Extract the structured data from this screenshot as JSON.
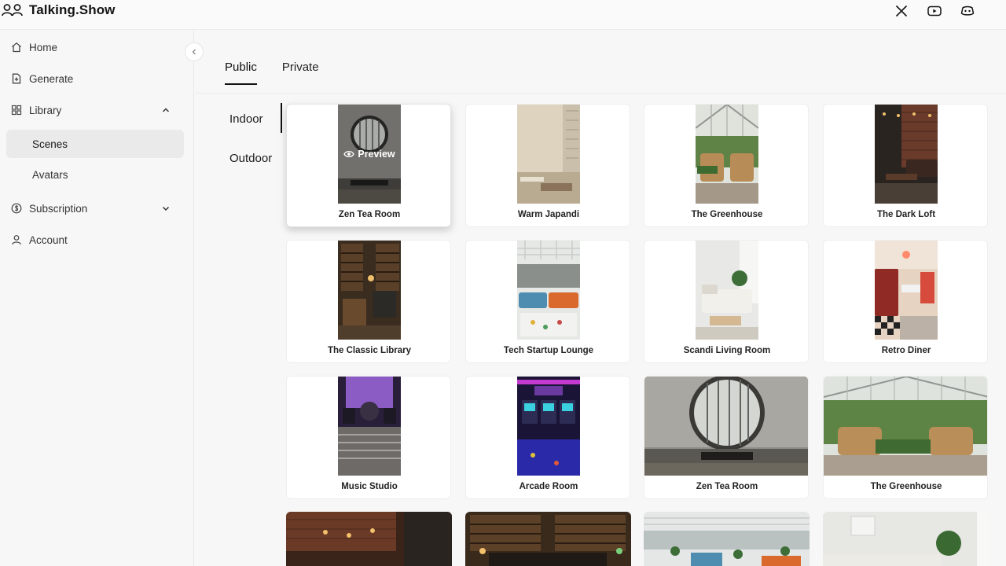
{
  "app": {
    "title": "Talking.Show"
  },
  "social": [
    {
      "icon": "x-twitter-icon"
    },
    {
      "icon": "youtube-icon"
    },
    {
      "icon": "discord-icon"
    }
  ],
  "sidebar": {
    "items": [
      {
        "label": "Home",
        "icon": "home-icon"
      },
      {
        "label": "Generate",
        "icon": "file-plus-icon"
      },
      {
        "label": "Library",
        "icon": "grid-icon",
        "expanded": true
      },
      {
        "label": "Scenes",
        "active": true
      },
      {
        "label": "Avatars"
      },
      {
        "label": "Subscription",
        "icon": "dollar-circle-icon",
        "expanded": false
      },
      {
        "label": "Account",
        "icon": "user-icon"
      }
    ]
  },
  "main": {
    "tabs": [
      {
        "label": "Public",
        "active": true
      },
      {
        "label": "Private"
      }
    ],
    "categories": [
      {
        "label": "Indoor",
        "active": true
      },
      {
        "label": "Outdoor"
      }
    ],
    "preview_label": "Preview",
    "cards": [
      {
        "label": "Zen Tea Room"
      },
      {
        "label": "Warm Japandi"
      },
      {
        "label": "The Greenhouse"
      },
      {
        "label": "The Dark Loft"
      },
      {
        "label": "The Classic Library"
      },
      {
        "label": "Tech Startup Lounge"
      },
      {
        "label": "Scandi Living Room"
      },
      {
        "label": "Retro Diner"
      },
      {
        "label": "Music Studio"
      },
      {
        "label": "Arcade Room"
      },
      {
        "label": "Zen Tea Room"
      },
      {
        "label": "The Greenhouse"
      }
    ]
  },
  "colors": {
    "accent": "#111111",
    "background": "#f7f7f7",
    "card": "#ffffff"
  }
}
